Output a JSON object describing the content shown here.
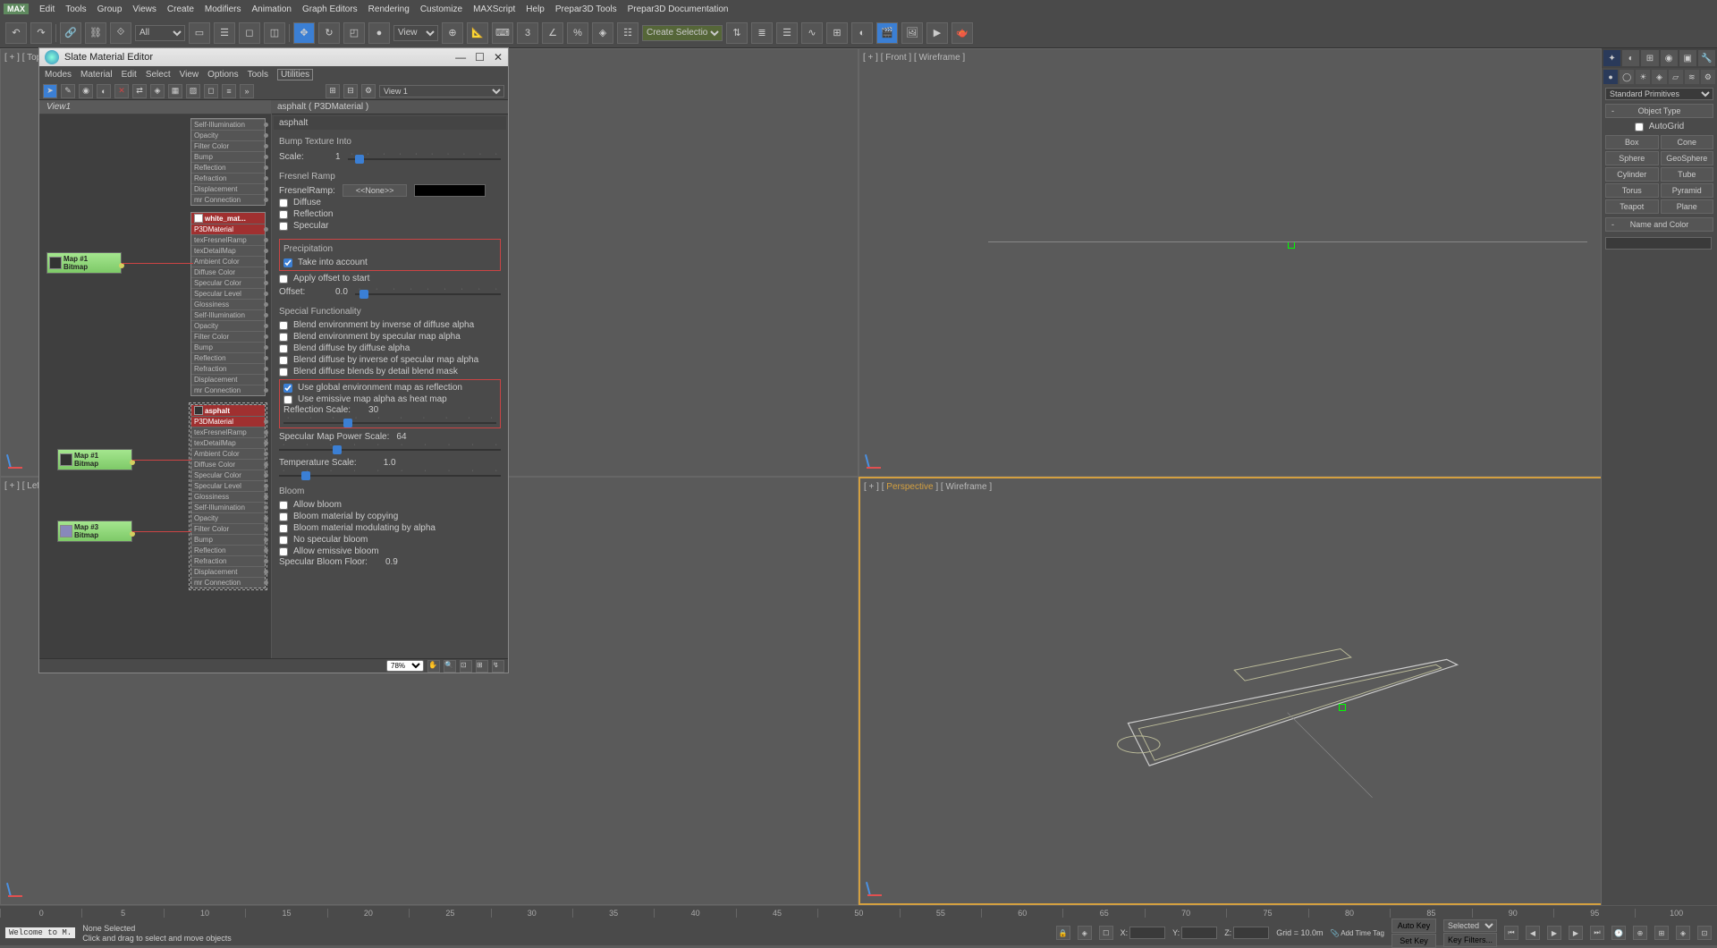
{
  "top_menu": [
    "Edit",
    "Tools",
    "Group",
    "Views",
    "Create",
    "Modifiers",
    "Animation",
    "Graph Editors",
    "Rendering",
    "Customize",
    "MAXScript",
    "Help",
    "Prepar3D Tools",
    "Prepar3D Documentation"
  ],
  "toolbar": {
    "all_dropdown": "All",
    "view_dropdown": "View",
    "sel_dropdown": "Create Selection Se"
  },
  "slate": {
    "title": "Slate Material Editor",
    "menu": [
      "Modes",
      "Material",
      "Edit",
      "Select",
      "View",
      "Options",
      "Tools",
      "Utilities"
    ],
    "view_dropdown": "View 1",
    "view_tab": "View1",
    "material_title": "asphalt  ( P3DMaterial )",
    "material_name": "asphalt",
    "zoom": "78%",
    "nodes": {
      "mat1_header": "white_mat...",
      "mat1_sub": "P3DMaterial",
      "mat2_header": "asphalt",
      "mat2_sub": "P3DMaterial",
      "map1": "Map #1",
      "map1_type": "Bitmap",
      "map2": "Map #1",
      "map2_type": "Bitmap",
      "map3": "Map #3",
      "map3_type": "Bitmap",
      "rows": [
        "texFresnelRamp",
        "texDetailMap",
        "Ambient Color",
        "Diffuse Color",
        "Specular Color",
        "Specular Level",
        "Glossiness",
        "Self-Illumination",
        "Opacity",
        "Filter Color",
        "Bump",
        "Reflection",
        "Refraction",
        "Displacement",
        "mr Connection"
      ],
      "prerows": [
        "Self-Illumination",
        "Opacity",
        "Filter Color",
        "Bump",
        "Reflection",
        "Refraction",
        "Displacement",
        "mr Connection"
      ]
    },
    "props": {
      "bump_section": "Bump Texture Into",
      "scale_label": "Scale:",
      "scale_value": "1",
      "fresnel_section": "Fresnel Ramp",
      "fresnel_label": "FresnelRamp:",
      "none_btn": "<<None>>",
      "cb_diffuse": "Diffuse",
      "cb_reflection": "Reflection",
      "cb_specular": "Specular",
      "precip_section": "Precipitation",
      "cb_take_account": "Take into account",
      "cb_apply_offset": "Apply offset to start",
      "offset_label": "Offset:",
      "offset_value": "0.0",
      "special_section": "Special Functionality",
      "cb_blend_env_inv_diff": "Blend environment by inverse of diffuse alpha",
      "cb_blend_env_spec": "Blend environment by specular map alpha",
      "cb_blend_diff_alpha": "Blend diffuse by diffuse alpha",
      "cb_blend_diff_inv_spec": "Blend diffuse by inverse of specular map alpha",
      "cb_blend_detail": "Blend diffuse blends by detail blend mask",
      "cb_use_global_env": "Use global environment map as reflection",
      "cb_use_emissive_heat": "Use emissive map alpha as heat map",
      "refl_scale_label": "Reflection Scale:",
      "refl_scale_value": "30",
      "spec_power_label": "Specular Map Power Scale:",
      "spec_power_value": "64",
      "temp_scale_label": "Temperature Scale:",
      "temp_scale_value": "1.0",
      "bloom_section": "Bloom",
      "cb_allow_bloom": "Allow bloom",
      "cb_bloom_copy": "Bloom material by copying",
      "cb_bloom_modulate": "Bloom material modulating by alpha",
      "cb_no_spec_bloom": "No specular bloom",
      "cb_allow_emissive_bloom": "Allow emissive bloom",
      "spec_bloom_floor_label": "Specular Bloom Floor:",
      "spec_bloom_floor_value": "0.9"
    }
  },
  "viewports": {
    "top": "[ + ] [ Top ]",
    "front": "[ + ] [ Front ] [ Wireframe ]",
    "left": "[ + ] [ Left ]",
    "persp_pre": "[ + ] [ ",
    "persp_mid": "Perspective",
    "persp_post": " ] [ Wireframe ]"
  },
  "cmd_panel": {
    "dropdown": "Standard Primitives",
    "object_type": "Object Type",
    "autogrid": "AutoGrid",
    "primitives": [
      "Box",
      "Cone",
      "Sphere",
      "GeoSphere",
      "Cylinder",
      "Tube",
      "Torus",
      "Pyramid",
      "Teapot",
      "Plane"
    ],
    "name_color": "Name and Color"
  },
  "timeline": [
    "0",
    "5",
    "10",
    "15",
    "20",
    "25",
    "30",
    "35",
    "40",
    "45",
    "50",
    "55",
    "60",
    "65",
    "70",
    "75",
    "80",
    "85",
    "90",
    "95",
    "100"
  ],
  "status": {
    "welcome": "Welcome to M.",
    "none_selected": "None Selected",
    "prompt": "Click and drag to select and move objects",
    "x_label": "X:",
    "y_label": "Y:",
    "z_label": "Z:",
    "grid": "Grid = 10.0m",
    "auto_key": "Auto Key",
    "set_key": "Set Key",
    "selected": "Selected",
    "key_filters": "Key Filters...",
    "add_time_tag": "Add Time Tag"
  }
}
